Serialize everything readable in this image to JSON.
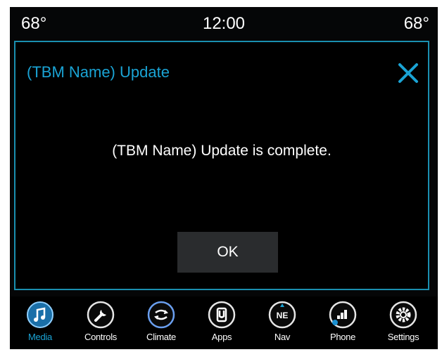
{
  "status": {
    "temp_left": "68°",
    "clock": "12:00",
    "temp_right": "68°"
  },
  "dialog": {
    "title": "(TBM Name) Update",
    "message": "(TBM Name) Update is complete.",
    "ok_label": "OK",
    "close_icon": "close-icon"
  },
  "nav": {
    "active": "Media",
    "items": [
      {
        "label": "Media",
        "icon": "music-note-icon"
      },
      {
        "label": "Controls",
        "icon": "wrench-icon"
      },
      {
        "label": "Climate",
        "icon": "climate-fan-icon"
      },
      {
        "label": "Apps",
        "icon": "apps-icon"
      },
      {
        "label": "Nav",
        "icon": "compass-icon"
      },
      {
        "label": "Phone",
        "icon": "phone-signal-icon"
      },
      {
        "label": "Settings",
        "icon": "gear-icon"
      }
    ]
  },
  "colors": {
    "accent": "#1aa3d4",
    "background": "#050607",
    "button": "#2a2c2e"
  }
}
